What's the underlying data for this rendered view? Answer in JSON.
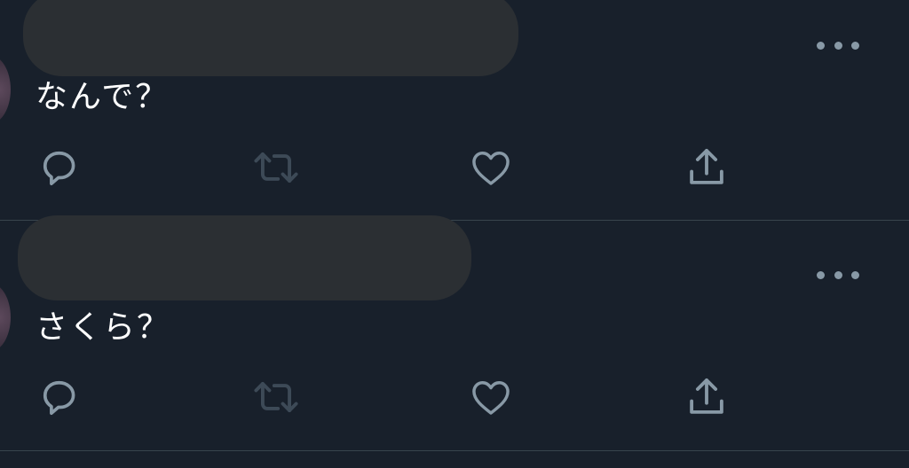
{
  "colors": {
    "background": "#18202b",
    "divider": "#38444d",
    "icon": "#8899a6",
    "icon_disabled": "#3d4a57",
    "text": "#ffffff",
    "redaction": "#2b2f33"
  },
  "tweets": [
    {
      "text": "なんで？",
      "more_icon": "more-horizontal-icon",
      "actions": [
        {
          "icon": "reply-icon"
        },
        {
          "icon": "retweet-icon",
          "disabled": true
        },
        {
          "icon": "like-icon"
        },
        {
          "icon": "share-icon"
        }
      ]
    },
    {
      "text": "さくら？",
      "more_icon": "more-horizontal-icon",
      "actions": [
        {
          "icon": "reply-icon"
        },
        {
          "icon": "retweet-icon",
          "disabled": true
        },
        {
          "icon": "like-icon"
        },
        {
          "icon": "share-icon"
        }
      ]
    }
  ]
}
